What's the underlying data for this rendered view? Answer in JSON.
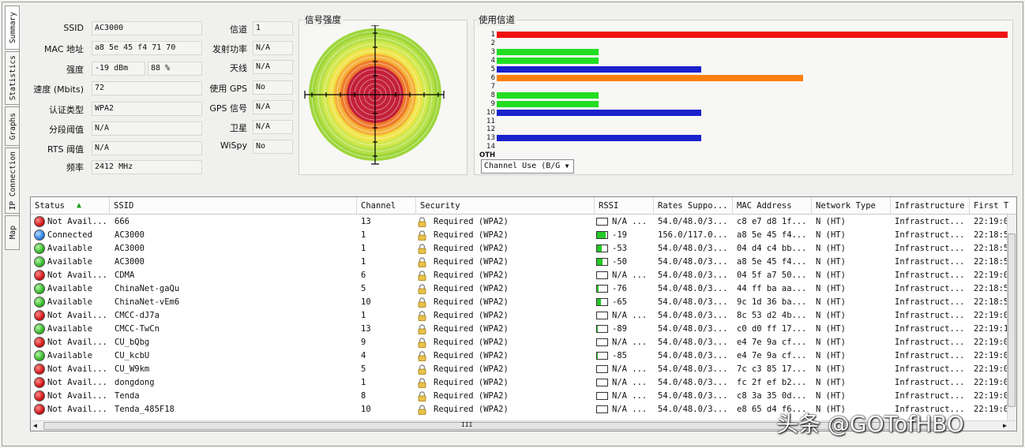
{
  "tabs": [
    "Summary",
    "Statistics",
    "Graphs",
    "IP Connection",
    "Map"
  ],
  "info": {
    "ssid_label": "SSID",
    "ssid": "AC3000",
    "mac_label": "MAC 地址",
    "mac": "a8 5e 45 f4 71 70",
    "strength_label": "强度",
    "strength_dbm": "-19 dBm",
    "strength_pct": "88 %",
    "speed_label": "速度 (Mbits)",
    "speed": "72",
    "auth_label": "认证类型",
    "auth": "WPA2",
    "frag_label": "分段阈值",
    "frag": "N/A",
    "rts_label": "RTS 阈值",
    "rts": "N/A",
    "freq_label": "频率",
    "freq": "2412 MHz",
    "channel_label": "信道",
    "channel": "1",
    "txpower_label": "发射功率",
    "txpower": "N/A",
    "antenna_label": "天线",
    "antenna": "N/A",
    "gps_label": "使用 GPS",
    "gps": "No",
    "gps_signal_label": "GPS 信号",
    "gps_signal": "N/A",
    "satellite_label": "卫星",
    "satellite": "N/A",
    "wispy_label": "WiSpy",
    "wispy": "No"
  },
  "signal": {
    "title": "信号强度"
  },
  "channel_use": {
    "title": "使用信道",
    "channels": [
      "1",
      "2",
      "3",
      "4",
      "5",
      "6",
      "7",
      "8",
      "9",
      "10",
      "11",
      "12",
      "13",
      "14",
      "OTH"
    ],
    "bars": [
      {
        "ch": "1",
        "count": 5,
        "color": "#ee1111"
      },
      {
        "ch": "3",
        "count": 1,
        "color": "#22dd22"
      },
      {
        "ch": "4",
        "count": 1,
        "color": "#22dd22"
      },
      {
        "ch": "5",
        "count": 2,
        "color": "#1a22cc"
      },
      {
        "ch": "6",
        "count": 3,
        "color": "#ff7f0e"
      },
      {
        "ch": "8",
        "count": 1,
        "color": "#22dd22"
      },
      {
        "ch": "9",
        "count": 1,
        "color": "#22dd22"
      },
      {
        "ch": "10",
        "count": 2,
        "color": "#1a22cc"
      },
      {
        "ch": "13",
        "count": 2,
        "color": "#1a22cc"
      }
    ],
    "max_count": 5,
    "select_label": "Channel Use (B/G"
  },
  "table": {
    "columns": [
      "Status",
      "SSID",
      "Channel",
      "Security",
      "RSSI",
      "Rates Suppo...",
      "MAC Address",
      "Network Type",
      "Infrastructure",
      "First T"
    ],
    "rows": [
      {
        "status": "red",
        "status_text": "Not Avail...",
        "ssid": "666",
        "channel": "13",
        "security": "Required (WPA2)",
        "rssi_fill": 0,
        "rssi": "N/A ...",
        "rates": "54.0/48.0/3...",
        "mac": "c8 e7 d8 1f...",
        "net": "N (HT)",
        "infra": "Infrastruct...",
        "first": "22:19:0"
      },
      {
        "status": "blue",
        "status_text": "Connected",
        "ssid": "AC3000",
        "channel": "1",
        "security": "Required (WPA2)",
        "rssi_fill": 0.88,
        "rssi": "-19",
        "rates": "156.0/117.0...",
        "mac": "a8 5e 45 f4...",
        "net": "N (HT)",
        "infra": "Infrastruct...",
        "first": "22:18:5"
      },
      {
        "status": "green",
        "status_text": "Available",
        "ssid": "AC3000",
        "channel": "1",
        "security": "Required (WPA2)",
        "rssi_fill": 0.45,
        "rssi": "-53",
        "rates": "54.0/48.0/3...",
        "mac": "04 d4 c4 bb...",
        "net": "N (HT)",
        "infra": "Infrastruct...",
        "first": "22:18:5"
      },
      {
        "status": "green",
        "status_text": "Available",
        "ssid": "AC3000",
        "channel": "1",
        "security": "Required (WPA2)",
        "rssi_fill": 0.5,
        "rssi": "-50",
        "rates": "54.0/48.0/3...",
        "mac": "a8 5e 45 f4...",
        "net": "N (HT)",
        "infra": "Infrastruct...",
        "first": "22:18:5"
      },
      {
        "status": "red",
        "status_text": "Not Avail...",
        "ssid": "CDMA",
        "channel": "6",
        "security": "Required (WPA2)",
        "rssi_fill": 0,
        "rssi": "N/A ...",
        "rates": "54.0/48.0/3...",
        "mac": "04 5f a7 50...",
        "net": "N (HT)",
        "infra": "Infrastruct...",
        "first": "22:19:0"
      },
      {
        "status": "green",
        "status_text": "Available",
        "ssid": "ChinaNet-gaQu",
        "channel": "5",
        "security": "Required (WPA2)",
        "rssi_fill": 0.15,
        "rssi": "-76",
        "rates": "54.0/48.0/3...",
        "mac": "44 ff ba aa...",
        "net": "N (HT)",
        "infra": "Infrastruct...",
        "first": "22:18:5"
      },
      {
        "status": "green",
        "status_text": "Available",
        "ssid": "ChinaNet-vEm6",
        "channel": "10",
        "security": "Required (WPA2)",
        "rssi_fill": 0.35,
        "rssi": "-65",
        "rates": "54.0/48.0/3...",
        "mac": "9c 1d 36 ba...",
        "net": "N (HT)",
        "infra": "Infrastruct...",
        "first": "22:18:5"
      },
      {
        "status": "red",
        "status_text": "Not Avail...",
        "ssid": "CMCC-dJ7a",
        "channel": "1",
        "security": "Required (WPA2)",
        "rssi_fill": 0,
        "rssi": "N/A ...",
        "rates": "54.0/48.0/3...",
        "mac": "8c 53 d2 4b...",
        "net": "N (HT)",
        "infra": "Infrastruct...",
        "first": "22:19:0"
      },
      {
        "status": "green",
        "status_text": "Available",
        "ssid": "CMCC-TwCn",
        "channel": "13",
        "security": "Required (WPA2)",
        "rssi_fill": 0.05,
        "rssi": "-89",
        "rates": "54.0/48.0/3...",
        "mac": "c0 d0 ff 17...",
        "net": "N (HT)",
        "infra": "Infrastruct...",
        "first": "22:19:1"
      },
      {
        "status": "red",
        "status_text": "Not Avail...",
        "ssid": "CU_bQbg",
        "channel": "9",
        "security": "Required (WPA2)",
        "rssi_fill": 0,
        "rssi": "N/A ...",
        "rates": "54.0/48.0/3...",
        "mac": "e4 7e 9a cf...",
        "net": "N (HT)",
        "infra": "Infrastruct...",
        "first": "22:19:0"
      },
      {
        "status": "green",
        "status_text": "Available",
        "ssid": "CU_kcbU",
        "channel": "4",
        "security": "Required (WPA2)",
        "rssi_fill": 0.05,
        "rssi": "-85",
        "rates": "54.0/48.0/3...",
        "mac": "e4 7e 9a cf...",
        "net": "N (HT)",
        "infra": "Infrastruct...",
        "first": "22:19:0"
      },
      {
        "status": "red",
        "status_text": "Not Avail...",
        "ssid": "CU_W9km",
        "channel": "5",
        "security": "Required (WPA2)",
        "rssi_fill": 0,
        "rssi": "N/A ...",
        "rates": "54.0/48.0/3...",
        "mac": "7c c3 85 17...",
        "net": "N (HT)",
        "infra": "Infrastruct...",
        "first": "22:19:0"
      },
      {
        "status": "red",
        "status_text": "Not Avail...",
        "ssid": "dongdong",
        "channel": "1",
        "security": "Required (WPA2)",
        "rssi_fill": 0,
        "rssi": "N/A ...",
        "rates": "54.0/48.0/3...",
        "mac": "fc 2f ef b2...",
        "net": "N (HT)",
        "infra": "Infrastruct...",
        "first": "22:19:0"
      },
      {
        "status": "red",
        "status_text": "Not Avail...",
        "ssid": "Tenda",
        "channel": "8",
        "security": "Required (WPA2)",
        "rssi_fill": 0,
        "rssi": "N/A ...",
        "rates": "54.0/48.0/3...",
        "mac": "c8 3a 35 0d...",
        "net": "N (HT)",
        "infra": "Infrastruct...",
        "first": "22:19:0"
      },
      {
        "status": "red",
        "status_text": "Not Avail...",
        "ssid": "Tenda_485F18",
        "channel": "10",
        "security": "Required (WPA2)",
        "rssi_fill": 0,
        "rssi": "N/A ...",
        "rates": "54.0/48.0/3...",
        "mac": "e8 65 d4 f6...",
        "net": "N (HT)",
        "infra": "Infrastruct...",
        "first": "22:19:0"
      }
    ],
    "hscroll_label": "III"
  },
  "watermark": "头条 @GOTofHBO"
}
